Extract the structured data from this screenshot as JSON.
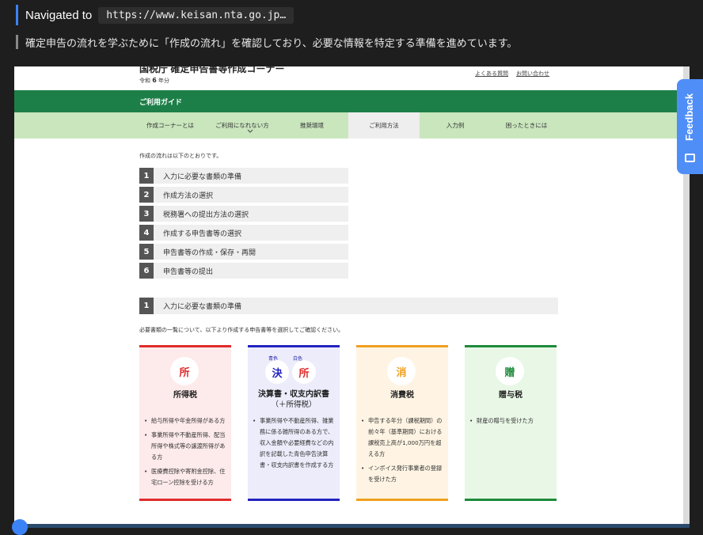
{
  "log": {
    "navigated_label": "Navigated to",
    "url": "https://www.keisan.nta.go.jp…",
    "status": "確定申告の流れを学ぶために「作成の流れ」を確認しており、必要な情報を特定する準備を進めています。"
  },
  "site": {
    "title": "国税庁 確定申告書等作成コーナー",
    "reiwa_prefix": "令和",
    "reiwa_num": "6",
    "reiwa_suffix": "年分",
    "links": [
      "よくある質問",
      "お問い合わせ"
    ]
  },
  "guide": {
    "title": "ご利用ガイド",
    "nav": [
      "作成コーナーとは",
      "ご利用になれない方",
      "推奨環境",
      "ご利用方法",
      "入力例",
      "困ったときには"
    ],
    "active_index": 3
  },
  "flow": {
    "intro": "作成の流れは以下のとおりです。",
    "steps": [
      {
        "num": "1",
        "label": "入力に必要な書類の準備"
      },
      {
        "num": "2",
        "label": "作成方法の選択"
      },
      {
        "num": "3",
        "label": "税務署への提出方法の選択"
      },
      {
        "num": "4",
        "label": "作成する申告書等の選択"
      },
      {
        "num": "5",
        "label": "申告書等の作成・保存・再開"
      },
      {
        "num": "6",
        "label": "申告書等の提出"
      }
    ]
  },
  "section1": {
    "num": "1",
    "label": "入力に必要な書類の準備",
    "desc": "必要書類の一覧について、以下より作成する申告書等を選択してご確認ください。"
  },
  "cards": [
    {
      "icon": "所",
      "title": "所得税",
      "accent": "#e02b2b",
      "bg": "#fdeaea",
      "items": [
        "給与所得や年金所得がある方",
        "事業所得や不動産所得、配当所得や株式等の譲渡所得がある方",
        "医療費控除や寄附金控除、住宅ローン控除を受ける方"
      ]
    },
    {
      "icon": "決",
      "icon2": "所",
      "tag1": "青色",
      "tag2": "白色",
      "title": "決算書・収支内訳書",
      "title2": "（＋所得税）",
      "accent": "#2323c0",
      "bg": "#ececfb",
      "items": [
        "事業所得や不動産所得、雑業務に係る雑所得のある方で、収入金額や必要経費などの内訳を記載した青色申告決算書・収支内訳書を作成する方"
      ]
    },
    {
      "icon": "消",
      "title": "消費税",
      "accent": "#f0a01e",
      "bg": "#fff4e3",
      "items": [
        "申告する年分（課税期間）の前々年（基準期間）における課税売上高が1,000万円を超える方",
        "インボイス発行事業者の登録を受けた方"
      ]
    },
    {
      "icon": "贈",
      "title": "贈与税",
      "accent": "#1d8a3a",
      "bg": "#e8f7e6",
      "items": [
        "財産の贈与を受けた方"
      ]
    }
  ],
  "feedback": {
    "label": "Feedback"
  },
  "colors": {
    "green": "#1d7f48",
    "nav_green": "#c9e6bd",
    "blue": "#3b82f6"
  }
}
